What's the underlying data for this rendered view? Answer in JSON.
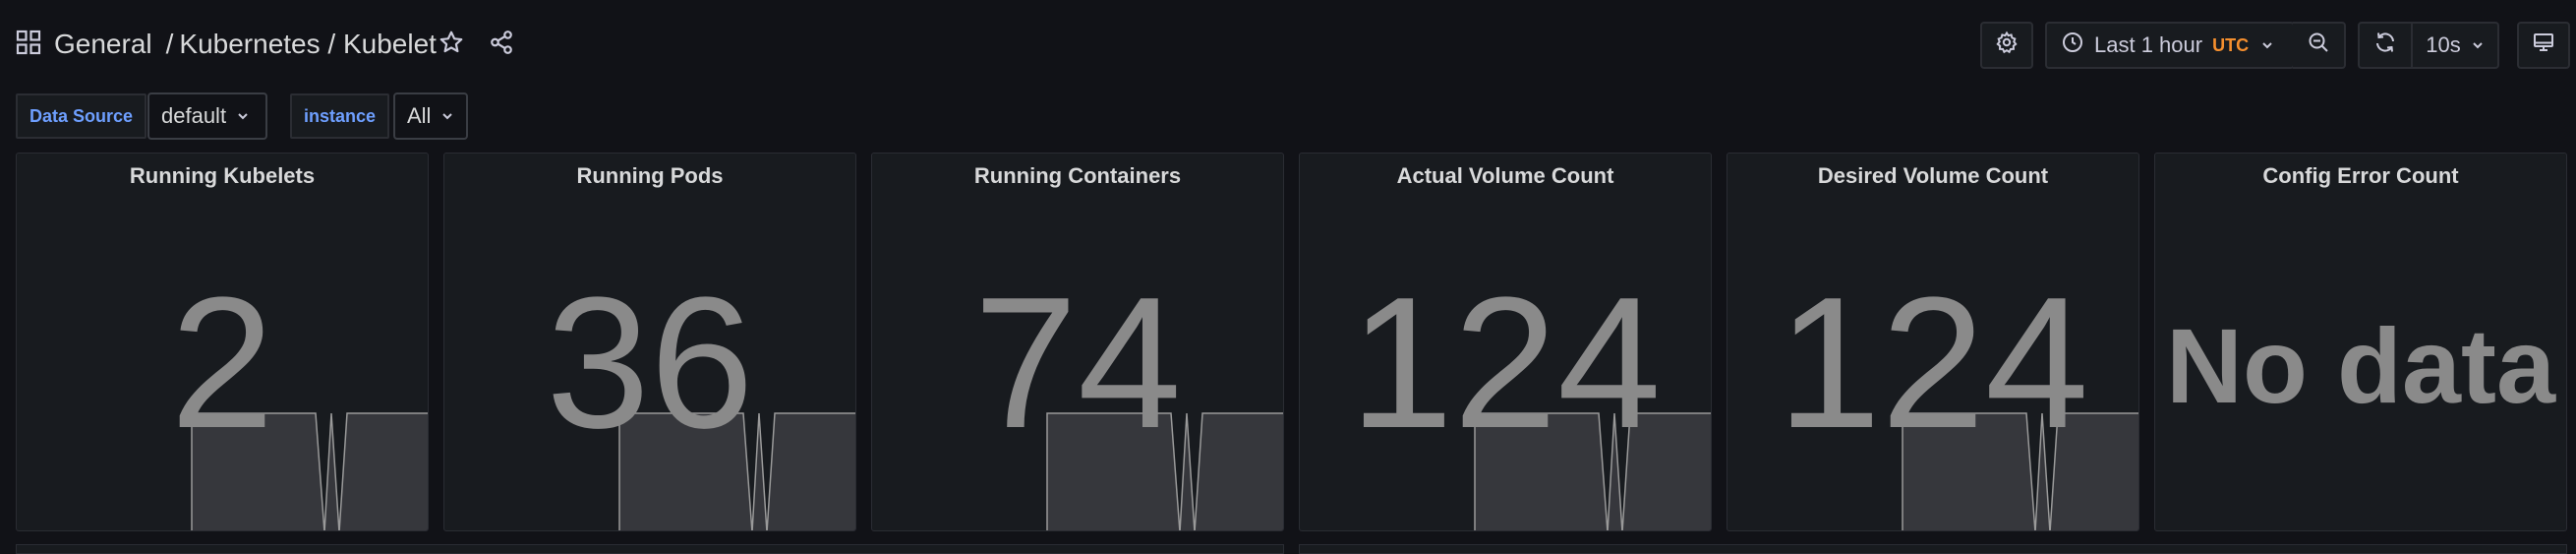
{
  "breadcrumb": {
    "folder": "General",
    "separator": "/",
    "dashboard": "Kubernetes / Kubelet"
  },
  "icons": {
    "apps": "grid-icon",
    "star": "star-icon",
    "share": "share-icon",
    "settings": "gear-icon",
    "time": "clock-icon",
    "zoom": "zoom-out-icon",
    "refresh": "refresh-icon",
    "tv": "monitor-icon",
    "chevron": "chevron-down-icon"
  },
  "toolbar": {
    "time_range": "Last 1 hour",
    "timezone": "UTC",
    "refresh_interval": "10s"
  },
  "variables": [
    {
      "label": "Data Source",
      "value": "default"
    },
    {
      "label": "instance",
      "value": "All"
    }
  ],
  "panels": [
    {
      "title": "Running Kubelets",
      "value": "2",
      "sparkline": true
    },
    {
      "title": "Running Pods",
      "value": "36",
      "sparkline": true
    },
    {
      "title": "Running Containers",
      "value": "74",
      "sparkline": true
    },
    {
      "title": "Actual Volume Count",
      "value": "124",
      "sparkline": true
    },
    {
      "title": "Desired Volume Count",
      "value": "124",
      "sparkline": true
    },
    {
      "title": "Config Error Count",
      "value": "No data",
      "sparkline": false
    }
  ],
  "colors": {
    "background": "#111217",
    "panel": "#181b1f",
    "accent_blue": "#6e9fff",
    "utc_orange": "#f58f2e",
    "stat_value": "#8a8a8a"
  }
}
